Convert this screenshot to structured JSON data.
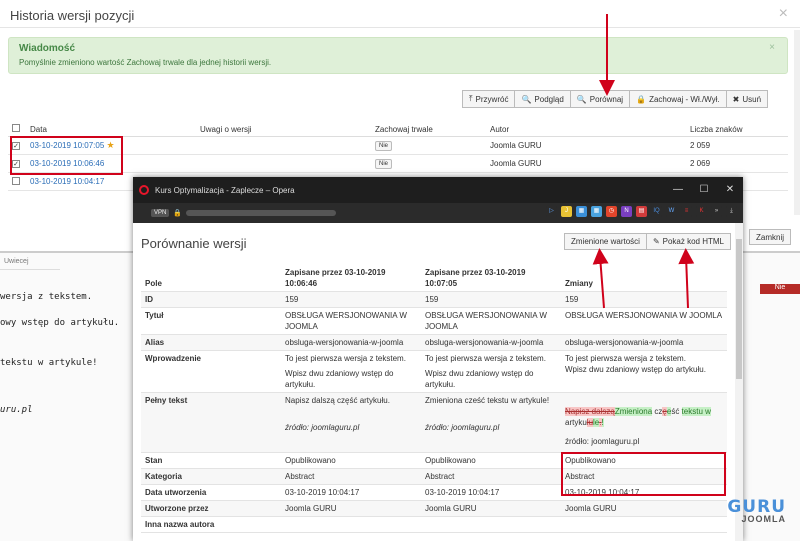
{
  "background": {
    "tab": "Uwiecej",
    "lines": [
      "wersja z tekstem.",
      "owy wstęp do artykułu.",
      "tekstu w artykule!",
      "uru.pl"
    ],
    "badge": "Nie"
  },
  "history_modal": {
    "title": "Historia wersji pozycji",
    "close": "×",
    "alert": {
      "title": "Wiadomość",
      "text": "Pomyślnie zmieniono wartość Zachowaj trwale dla jednej historii wersji.",
      "close": "×"
    },
    "toolbar": [
      {
        "icon": "⤒",
        "label": "Przywróć"
      },
      {
        "icon": "🔍",
        "label": "Podgląd"
      },
      {
        "icon": "🔍",
        "label": "Porównaj"
      },
      {
        "icon": "🔒",
        "label": "Zachowaj - Wł./Wył."
      },
      {
        "icon": "✖",
        "label": "Usuń"
      }
    ],
    "columns": [
      "Data",
      "Uwagi o wersji",
      "Zachowaj trwale",
      "Autor",
      "Liczba znaków"
    ],
    "rows": [
      {
        "checked": "✓",
        "date": "03-10-2019 10:07:05",
        "star": "★",
        "keep": "Nie",
        "author": "Joomla GURU",
        "chars": "2 059"
      },
      {
        "checked": "✓",
        "date": "03-10-2019 10:06:46",
        "star": "",
        "keep": "Nie",
        "author": "Joomla GURU",
        "chars": "2 069"
      },
      {
        "checked": "",
        "date": "03-10-2019 10:04:17",
        "star": "",
        "keep": "",
        "author": "",
        "chars": ""
      }
    ],
    "close_button": "Zamknij"
  },
  "opera": {
    "window_title": "Kurs Optymalizacja - Zaplecze – Opera",
    "vpn": "VPN",
    "page_title": "Porównanie wersji",
    "buttons": {
      "changed": "Zmienione wartości",
      "html": "Pokaż kod HTML"
    },
    "header": {
      "field": "Pole",
      "col1": "Zapisane przez 03-10-2019 10:06:46",
      "col2": "Zapisane przez 03-10-2019 10:07:05",
      "col3": "Zmiany"
    },
    "rows": {
      "id": {
        "label": "ID",
        "a": "159",
        "b": "159",
        "c": "159"
      },
      "title": {
        "label": "Tytuł",
        "a": "OBSŁUGA WERSJONOWANIA W JOOMLA",
        "b": "OBSŁUGA WERSJONOWANIA W JOOMLA",
        "c": "OBSŁUGA WERSJONOWANIA W JOOMLA"
      },
      "alias": {
        "label": "Alias",
        "a": "obsluga-wersjonowania-w-joomla",
        "b": "obsluga-wersjonowania-w-joomla",
        "c": "obsluga-wersjonowania-w-joomla"
      },
      "intro": {
        "label": "Wprowadzenie",
        "a1": "To jest pierwsza wersja z tekstem.",
        "a2": "Wpisz dwu zdaniowy wstęp do artykułu.",
        "b1": "To jest pierwsza wersja z tekstem.",
        "b2": "Wpisz dwu zdaniowy wstęp do artykułu.",
        "c1": "To jest pierwsza wersja z tekstem.",
        "c2": "Wpisz dwu zdaniowy wstęp do artykułu."
      },
      "full": {
        "label": "Pełny tekst",
        "a1": "Napisz dalszą część artykułu.",
        "a2": "źródło: joomlaguru.pl",
        "b1": "Zmieniona cześć tekstu w artykule!",
        "b2": "źródło: joomlaguru.pl",
        "c_del1": "Napisz dalszą",
        "c_ins1": "Zmieniona",
        "c_mid1": " cz",
        "c_del2": "ę",
        "c_ins2": "e",
        "c_mid2": "ść ",
        "c_ins3": "tekstu w",
        "c_mid3": " artyku",
        "c_del3": "łu",
        "c_ins4": "le",
        "c_del4": ".",
        "c_ins5": "!",
        "c2": "źródło: joomlaguru.pl"
      },
      "state": {
        "label": "Stan",
        "a": "Opublikowano",
        "b": "Opublikowano",
        "c": "Opublikowano"
      },
      "category": {
        "label": "Kategoria",
        "a": "Abstract",
        "b": "Abstract",
        "c": "Abstract"
      },
      "created": {
        "label": "Data utworzenia",
        "a": "03-10-2019 10:04:17",
        "b": "03-10-2019 10:04:17",
        "c": "03-10-2019 10:04:17"
      },
      "author": {
        "label": "Utworzone przez",
        "a": "Joomla GURU",
        "b": "Joomla GURU",
        "c": "Joomla GURU"
      },
      "alias_author": {
        "label": "Inna nazwa autora"
      }
    }
  },
  "watermark": {
    "top": "GURU",
    "bottom": "JOOMLA"
  },
  "colors": {
    "accent_red": "#d0021b",
    "link": "#2a6db7",
    "alert_bg": "#dff0d8"
  }
}
